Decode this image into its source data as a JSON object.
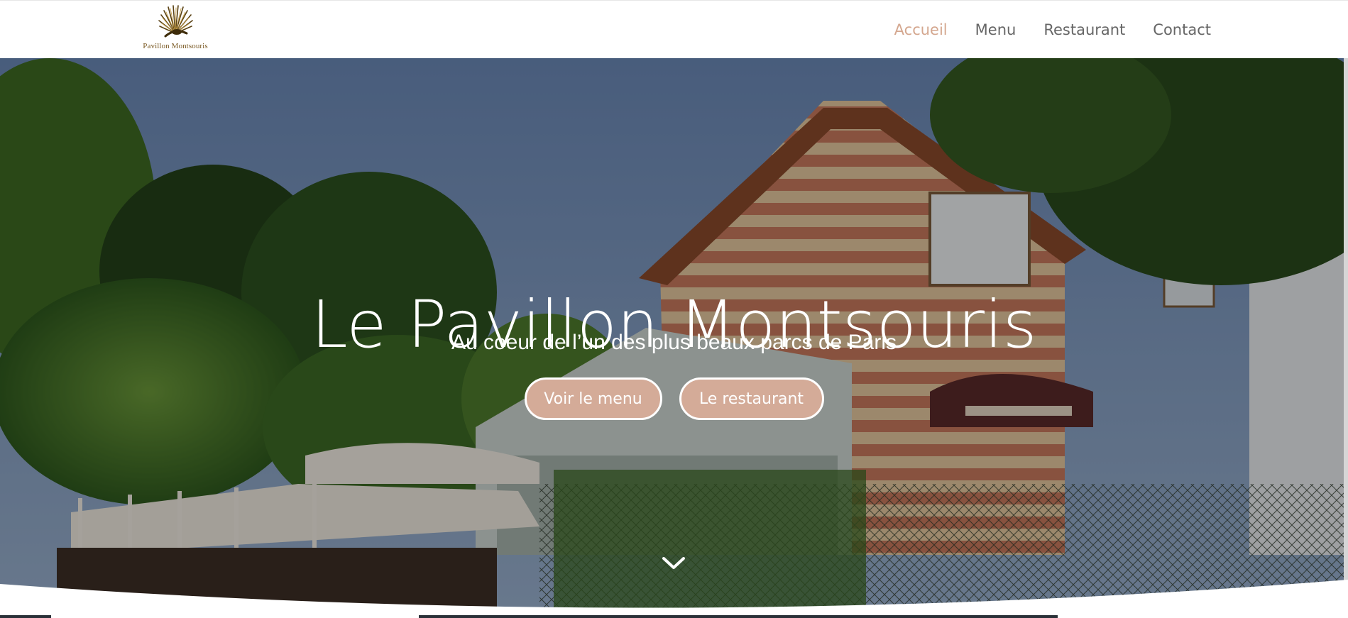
{
  "header": {
    "logo_text": "Pavillon Montsouris",
    "nav": [
      {
        "label": "Accueil",
        "active": true
      },
      {
        "label": "Menu",
        "active": false
      },
      {
        "label": "Restaurant",
        "active": false
      },
      {
        "label": "Contact",
        "active": false
      }
    ]
  },
  "hero": {
    "title": "Le Pavillon Montsouris",
    "subtitle": "Au coeur de l’un des plus beaux parcs de Paris",
    "buttons": {
      "menu_label": "Voir le menu",
      "restaurant_label": "Le restaurant"
    },
    "scroll_icon": "chevron-down-icon"
  },
  "colors": {
    "accent": "#d4a78f",
    "button_bg": "#d4ab98",
    "nav_text": "#666666",
    "white": "#ffffff"
  }
}
